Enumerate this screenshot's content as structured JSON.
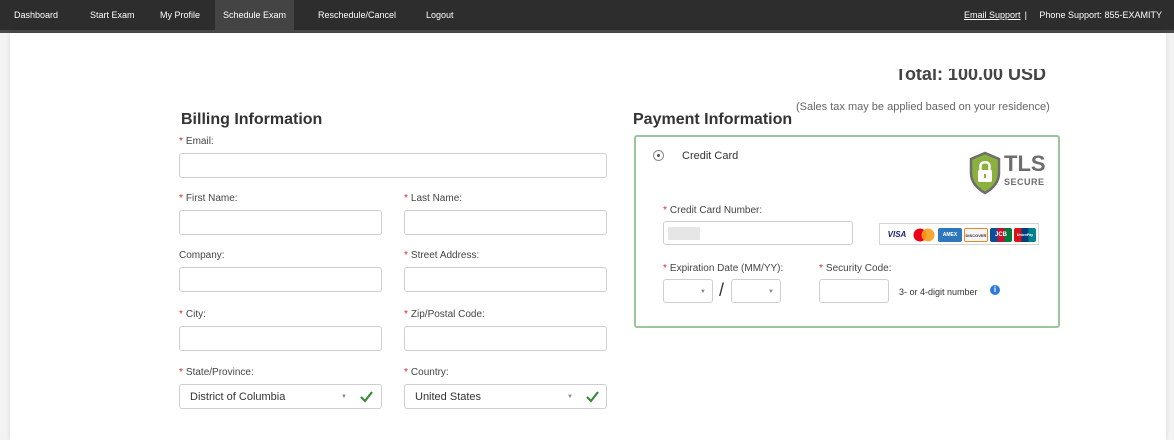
{
  "nav": {
    "items": [
      {
        "label": "Dashboard"
      },
      {
        "label": "Start Exam"
      },
      {
        "label": "My Profile"
      },
      {
        "label": "Schedule Exam"
      },
      {
        "label": "Reschedule/Cancel"
      },
      {
        "label": "Logout"
      }
    ],
    "active_item": "Schedule Exam",
    "email_support": "Email Support",
    "separator": "|",
    "phone_support": "Phone Support: 855-EXAMITY"
  },
  "order": {
    "total": "Total: 100.00 USD",
    "tax_note": "(Sales tax may be applied based on your residence)"
  },
  "billing": {
    "title": "Billing Information",
    "required_mark": "*",
    "email_label": "Email:",
    "email_value": "",
    "first_name_label": "First Name:",
    "first_name_value": "",
    "last_name_label": "Last Name:",
    "last_name_value": "",
    "company_label": "Company:",
    "company_value": "",
    "street_label": "Street Address:",
    "street_value": "",
    "city_label": "City:",
    "city_value": "",
    "zip_label": "Zip/Postal Code:",
    "zip_value": "",
    "state_label": "State/Province:",
    "state_value": "District of Columbia",
    "country_label": "Country:",
    "country_value": "United States"
  },
  "payment": {
    "title": "Payment Information",
    "method_label": "Credit Card",
    "tls_text": "TLS",
    "tls_secure": "SECURE",
    "card_number_label": "Credit Card Number:",
    "expiration_label": "Expiration Date (MM/YY):",
    "expiration_month": "",
    "expiration_year": "",
    "date_separator": "/",
    "security_code_label": "Security Code:",
    "security_code_value": "",
    "security_hint": "3- or 4-digit number",
    "info_icon": "i",
    "card_brands": [
      "VISA",
      "MC",
      "AMEX",
      "DISCOVER",
      "JCB",
      "UnionPay"
    ]
  },
  "colors": {
    "nav_bg": "#2d2d2d",
    "required": "#d9262b",
    "valid_check": "#3a8a3a",
    "payment_border": "#9bc59d",
    "info": "#2c7bd8"
  }
}
